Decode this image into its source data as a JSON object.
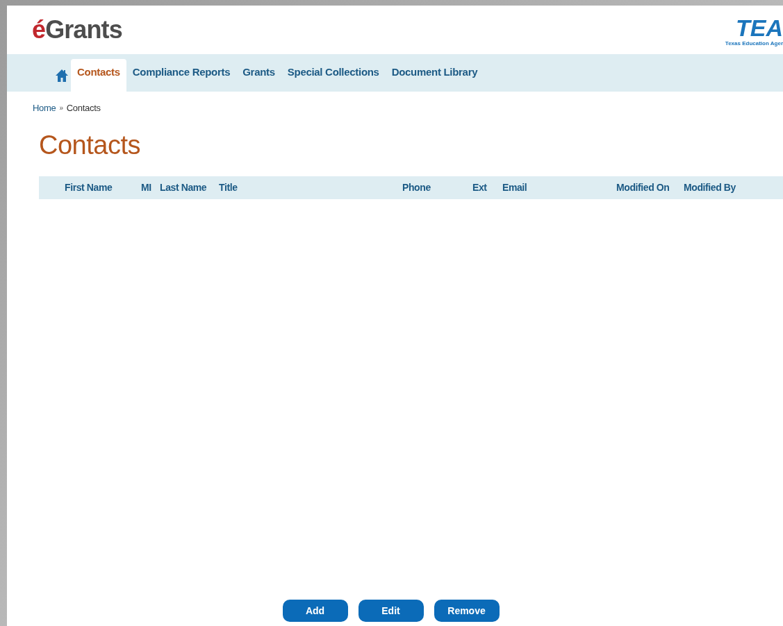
{
  "header": {
    "logo_accent": "é",
    "logo_text": "Grants",
    "agency_mark": "TEA",
    "agency_name": "Texas Education Ager"
  },
  "nav": {
    "tabs": [
      {
        "kind": "home",
        "selected": false
      },
      {
        "kind": "text",
        "label": "Contacts",
        "selected": true
      },
      {
        "kind": "text",
        "label": "Compliance Reports",
        "selected": false
      },
      {
        "kind": "text",
        "label": "Grants",
        "selected": false
      },
      {
        "kind": "text",
        "label": "Special Collections",
        "selected": false
      },
      {
        "kind": "text",
        "label": "Document Library",
        "selected": false
      }
    ]
  },
  "breadcrumb": [
    "Home",
    "»",
    "Contacts"
  ],
  "page_title": "Contacts",
  "table": {
    "columns": [
      "First Name",
      "MI",
      "Last Name",
      "Title",
      "Phone",
      "Ext",
      "Email",
      "Modified On",
      "Modified By"
    ]
  },
  "buttons": [
    "Add",
    "Edit",
    "Remove"
  ]
}
